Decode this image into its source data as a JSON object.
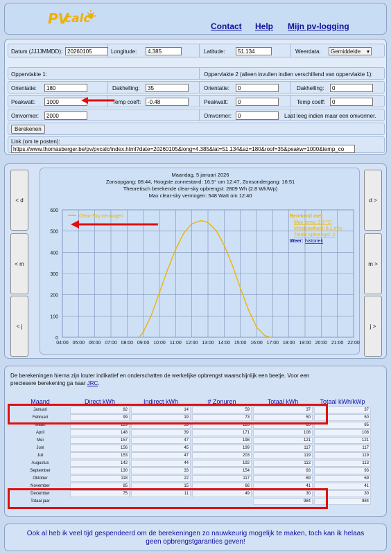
{
  "header": {
    "logo_pv": "PV",
    "logo_calc": "calc",
    "links": [
      "Contact",
      "Help",
      "Mijn pv-logging"
    ]
  },
  "form": {
    "datum_label": "Datum (JJJJMMDD):",
    "datum_value": "20260105",
    "longitude_label": "Longitude:",
    "longitude_value": "4.385",
    "latitude_label": "Latitude:",
    "latitude_value": "51.134",
    "weerdata_label": "Weerdata:",
    "weerdata_value": "Gemiddelde",
    "opp1_label": "Oppervlakte 1:",
    "opp2_label": "Oppervlakte 2 (alleen invullen indien verschillend van oppervlakte 1):",
    "orientatie_label": "Orientatie:",
    "orientatie1": "180",
    "orientatie2": "0",
    "dakhelling_label": "Dakhelling:",
    "dakhelling1": "35",
    "dakhelling2": "0",
    "peakwatt_label": "Peakwatt:",
    "peakwatt1": "1000",
    "peakwatt2": "0",
    "tempcoeff_label": "Temp coeff:",
    "tempcoeff1": "-0.48",
    "tempcoeff2": "0",
    "omvormer_label": "Omvormer:",
    "omvormer1": "2000",
    "omvormer2": "0",
    "omvormer_note": "Laat leeg indien maar een omvormer.",
    "berekenen": "Berekenen",
    "link_label": "Link (om te posten):",
    "link_value": "https://www.thomasberger.be/pv/pvcalc/index.html?date=20260105&long=4.385&lat=51.134&az=180&roof=35&peakw=1000&temp_co"
  },
  "nav": {
    "prev_day": "< d",
    "prev_month": "< m",
    "prev_year": "< j",
    "next_day": "d >",
    "next_month": "m >",
    "next_year": "j >"
  },
  "chart_data": {
    "type": "line",
    "title_lines": [
      "Maandag, 5 januari 2026",
      "Zonsopgang: 08:44, Hoogste zonnestand: 16.5° om 12:47, Zonsondergang: 16:51",
      "Theoretisch berekende clear-sky opbrengst: 2809 Wh (2.8 Wh/Wp)",
      "Max clear-sky vermogen: 548 Watt om 12:40"
    ],
    "legend": "Clear-Sky vermogen",
    "berekend_met": "Berekend met:",
    "berekend_lines": [
      "Max temp: 2.3 °C",
      "Windsnelheid: 6.1 m/s",
      "Totale opbrengst: 0"
    ],
    "weer_label": "Weer:",
    "weer_link": "historiek",
    "x_ticks": [
      "04:00",
      "05:00",
      "06:00",
      "07:00",
      "08:00",
      "09:00",
      "10:00",
      "11:00",
      "12:00",
      "13:00",
      "14:00",
      "15:00",
      "16:00",
      "17:00",
      "18:00",
      "19:00",
      "20:00",
      "21:00",
      "22:00"
    ],
    "y_ticks": [
      0,
      100,
      200,
      300,
      400,
      500,
      600
    ],
    "ylim": [
      0,
      600
    ],
    "x_hours": [
      8.74,
      9.0,
      9.5,
      10.0,
      10.5,
      11.0,
      11.5,
      12.0,
      12.5,
      12.67,
      13.0,
      13.5,
      14.0,
      14.5,
      15.0,
      15.5,
      16.0,
      16.5,
      16.85
    ],
    "y_watts": [
      0,
      24,
      103,
      210,
      318,
      413,
      490,
      534,
      548,
      548,
      540,
      503,
      434,
      341,
      232,
      130,
      48,
      8,
      0
    ],
    "line_color": "#f0b400",
    "grid": true
  },
  "table": {
    "intro": "De berekeningen hierna zijn louter indikatief en onderschatten de werkelijke opbrengst waarschijnlijk een beetje. Voor een preciesere berekening ga naar",
    "intro_link": "JRC",
    "headers": [
      "Maand",
      "Direct kWh",
      "Indirect kWh",
      "# Zonuren",
      "Totaal kWh",
      "Totaal kWh/kWp"
    ],
    "rows": [
      [
        "Januari",
        "82",
        "14",
        "59",
        "37",
        "37"
      ],
      [
        "Februari",
        "99",
        "19",
        "73",
        "50",
        "50"
      ],
      [
        "Maart",
        "129",
        "33",
        "126",
        "85",
        "85"
      ],
      [
        "April",
        "148",
        "39",
        "171",
        "108",
        "108"
      ],
      [
        "Mei",
        "157",
        "47",
        "198",
        "121",
        "121"
      ],
      [
        "Juni",
        "156",
        "45",
        "199",
        "117",
        "117"
      ],
      [
        "Juli",
        "153",
        "47",
        "203",
        "119",
        "119"
      ],
      [
        "Augustus",
        "142",
        "44",
        "192",
        "113",
        "113"
      ],
      [
        "September",
        "130",
        "33",
        "154",
        "93",
        "93"
      ],
      [
        "Oktober",
        "118",
        "22",
        "117",
        "69",
        "69"
      ],
      [
        "November",
        "85",
        "15",
        "66",
        "41",
        "41"
      ],
      [
        "December",
        "75",
        "11",
        "49",
        "30",
        "30"
      ]
    ],
    "total_label": "Totaal jaar",
    "total_kwh": "984",
    "total_kwp": "984"
  },
  "footer": "Ook al heb ik veel tijd gespendeerd om de berekeningen zo nauwkeurig mogelijk te maken, toch kan ik helaas geen opbrengstgaranties geven!",
  "accent_color": "#e01010"
}
